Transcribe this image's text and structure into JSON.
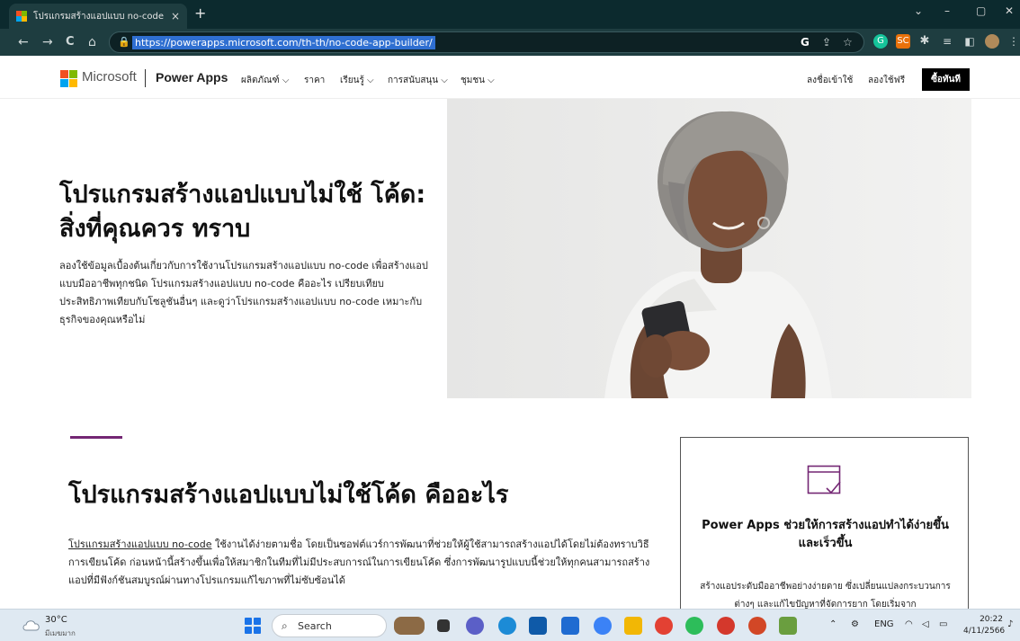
{
  "browser": {
    "tab_title": "โปรแกรมสร้างแอปแบบ no-code | M",
    "tab_close": "×",
    "new_tab": "+",
    "url": "https://powerapps.microsoft.com/th-th/no-code-app-builder/",
    "window_controls": [
      "⌄",
      "–",
      "▢",
      "✕"
    ],
    "nav": [
      "←",
      "→",
      "C",
      "⌂"
    ]
  },
  "header": {
    "brand": "Microsoft",
    "product": "Power Apps",
    "nav": [
      "ผลิตภัณฑ์ ⌵",
      "ราคา",
      "เรียนรู้ ⌵",
      "การสนับสนุน ⌵",
      "ชุมชน ⌵"
    ],
    "sign_in": "ลงชื่อเข้าใช้",
    "try_free": "ลองใช้ฟรี",
    "buy_now": "ซื้อทันที"
  },
  "hero": {
    "title": "โปรแกรมสร้างแอปแบบไม่ใช้ โค้ด: สิ่งที่คุณควร ทราบ",
    "body": "ลองใช้ข้อมูลเบื้องต้นเกี่ยวกับการใช้งานโปรแกรมสร้างแอปแบบ no-code เพื่อสร้างแอปแบบมืออาชีพทุกชนิด โปรแกรมสร้างแอปแบบ no-code คืออะไร เปรียบเทียบประสิทธิภาพเทียบกับโซลูชันอื่นๆ และดูว่าโปรแกรมสร้างแอปแบบ no-code เหมาะกับธุรกิจของคุณหรือไม่"
  },
  "section2": {
    "title": "โปรแกรมสร้างแอปแบบไม่ใช้โค้ด คืออะไร",
    "link_text": "โปรแกรมสร้างแอปแบบ no-code",
    "body": " ใช้งานได้ง่ายตามชื่อ โดยเป็นซอฟต์แวร์การพัฒนาที่ช่วยให้ผู้ใช้สามารถสร้างแอปได้โดยไม่ต้องทราบวิธีการเขียนโค้ด ก่อนหน้านี้สร้างขึ้นเพื่อให้สมาชิกในทีมที่ไม่มีประสบการณ์ในการเขียนโค้ด ซึ่งการพัฒนารูปแบบนี้ช่วยให้ทุกคนสามารถสร้างแอปที่มีฟังก์ชันสมบูรณ์ผ่านทางโปรแกรมแก้ไขภาพที่ไม่ซับซ้อนได้"
  },
  "card": {
    "title": "Power Apps ช่วยให้การสร้างแอปทำได้ง่ายขึ้นและเร็วขึ้น",
    "body": "สร้างแอประดับมืออาชีพอย่างง่ายดาย ซึ่งเปลี่ยนแปลงกระบวนการต่างๆ และแก้ไขปัญหาที่จัดการยาก โดยเริ่มจาก"
  },
  "taskbar": {
    "temperature": "30°C",
    "weather": "มีเมฆมาก",
    "search": "Search",
    "language": "ENG",
    "time": "20:22",
    "date": "4/11/2566"
  },
  "colors": {
    "accent": "#742774",
    "chrome": "#0c2a2e",
    "toolbar": "#1e3d40",
    "url_highlight": "#2f6fd1"
  }
}
